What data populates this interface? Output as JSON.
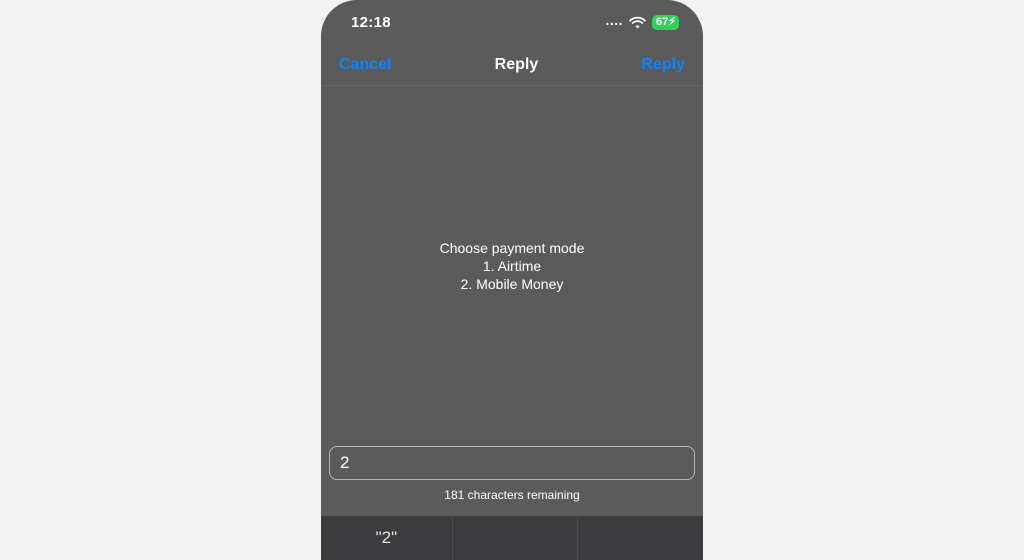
{
  "status": {
    "time": "12:18",
    "dots": "....",
    "battery": "67"
  },
  "nav": {
    "cancel": "Cancel",
    "title": "Reply",
    "reply": "Reply"
  },
  "content": {
    "line1": "Choose payment mode",
    "line2": "1. Airtime",
    "line3": "2. Mobile Money"
  },
  "input": {
    "value": "2"
  },
  "char_remaining": "181 characters remaining",
  "keyboard": {
    "suggestion1": "\"2\""
  }
}
